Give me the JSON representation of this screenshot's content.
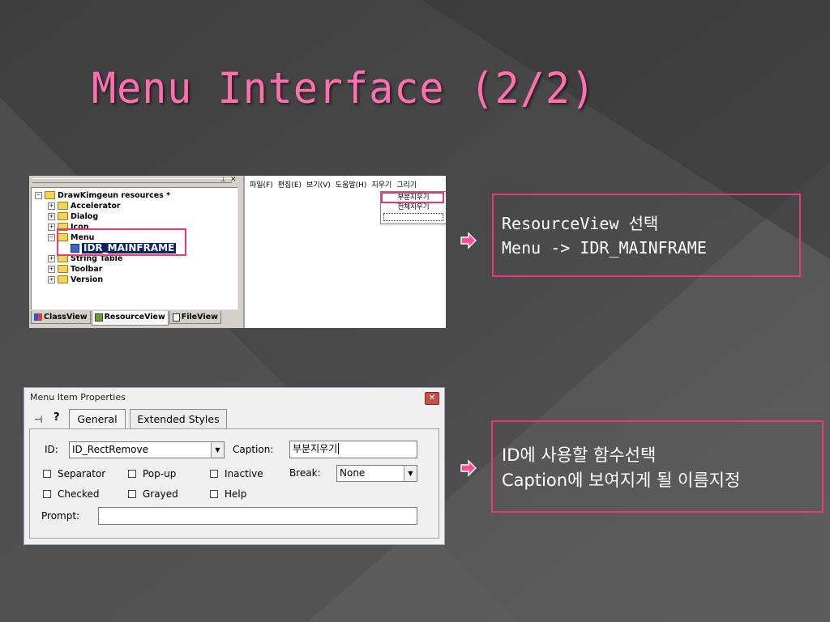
{
  "colors": {
    "accent": "#e8387c",
    "title": "#ff6fb0",
    "background": "#4a4a4a"
  },
  "slide": {
    "title": "Menu Interface (2/2)"
  },
  "resource_view": {
    "tree": {
      "root": "DrawKimgeun resources *",
      "items": [
        "Accelerator",
        "Dialog",
        "Icon",
        "Menu",
        "IDR_MAINFRAME",
        "String Table",
        "Toolbar",
        "Version"
      ]
    },
    "tabs": [
      "ClassView",
      "ResourceView",
      "FileView"
    ],
    "menubar": [
      "파일(F)",
      "편집(E)",
      "보기(V)",
      "도움말(H)",
      "지우기",
      "그리기"
    ],
    "popup": [
      "부분지우기",
      "전체지우기"
    ]
  },
  "dialog": {
    "title": "Menu Item Properties",
    "tabs": {
      "general": "General",
      "extended": "Extended Styles"
    },
    "id_label": "ID:",
    "id_value": "ID_RectRemove",
    "caption_label": "Caption:",
    "caption_value": "부분지우기",
    "checkboxes": [
      "Separator",
      "Pop-up",
      "Inactive",
      "Checked",
      "Grayed",
      "Help"
    ],
    "break_label": "Break:",
    "break_value": "None",
    "prompt_label": "Prompt:",
    "prompt_value": ""
  },
  "notes": {
    "first": [
      "ResourceView 선택",
      "Menu -> IDR_MAINFRAME"
    ],
    "second": [
      "ID에 사용할 함수선택",
      "Caption에 보여지게 될 이름지정"
    ]
  },
  "icons": {
    "arrow": "right-arrow-icon",
    "folder": "folder-icon",
    "close": "close-icon",
    "pin": "pin-icon",
    "help": "help-icon"
  }
}
